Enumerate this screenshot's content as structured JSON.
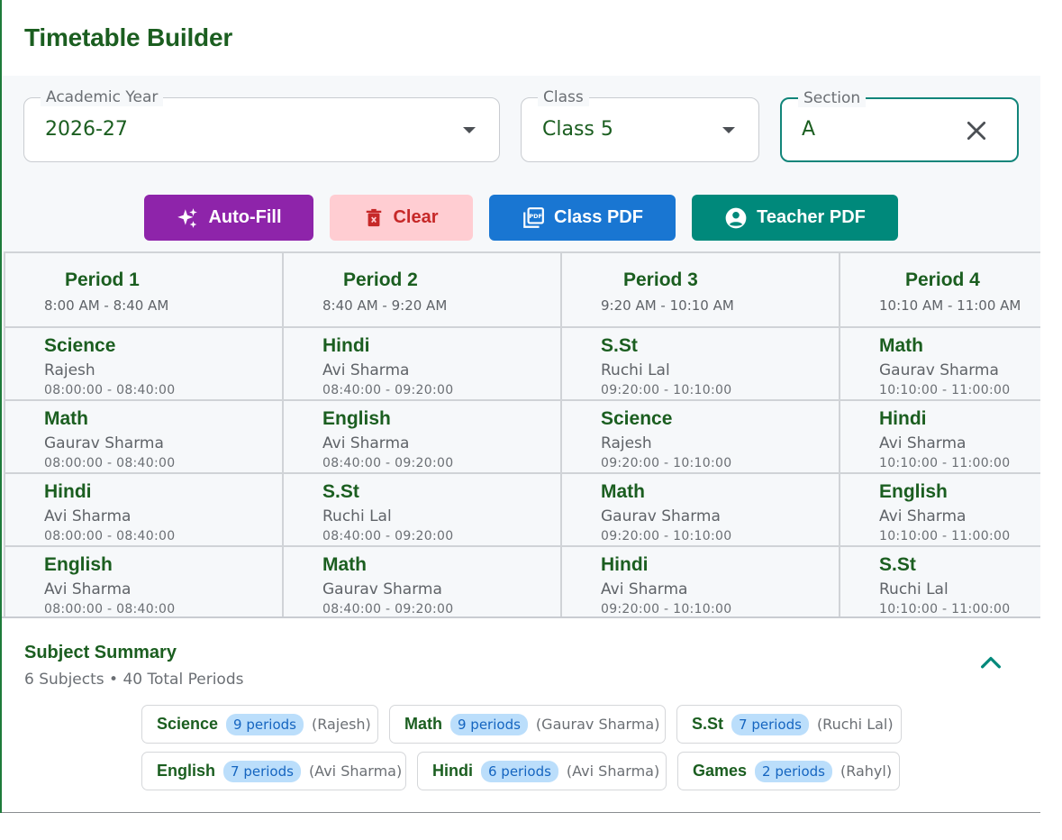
{
  "page": {
    "title": "Timetable Builder"
  },
  "filters": {
    "academic_year": {
      "label": "Academic Year",
      "value": "2026-27"
    },
    "class": {
      "label": "Class",
      "value": "Class 5"
    },
    "section": {
      "label": "Section",
      "value": "A"
    }
  },
  "toolbar": {
    "autofill_label": "Auto-Fill",
    "clear_label": "Clear",
    "class_pdf_label": "Class PDF",
    "teacher_pdf_label": "Teacher PDF"
  },
  "periods": [
    {
      "title": "Period 1",
      "time": "8:00 AM - 8:40 AM"
    },
    {
      "title": "Period 2",
      "time": "8:40 AM - 9:20 AM"
    },
    {
      "title": "Period 3",
      "time": "9:20 AM - 10:10 AM"
    },
    {
      "title": "Period 4",
      "time": "10:10 AM - 11:00 AM"
    }
  ],
  "rows": [
    [
      {
        "subject": "Science",
        "teacher": "Rajesh",
        "slot": "08:00:00 - 08:40:00"
      },
      {
        "subject": "Hindi",
        "teacher": "Avi Sharma",
        "slot": "08:40:00 - 09:20:00"
      },
      {
        "subject": "S.St",
        "teacher": "Ruchi Lal",
        "slot": "09:20:00 - 10:10:00"
      },
      {
        "subject": "Math",
        "teacher": "Gaurav Sharma",
        "slot": "10:10:00 - 11:00:00"
      }
    ],
    [
      {
        "subject": "Math",
        "teacher": "Gaurav Sharma",
        "slot": "08:00:00 - 08:40:00"
      },
      {
        "subject": "English",
        "teacher": "Avi Sharma",
        "slot": "08:40:00 - 09:20:00"
      },
      {
        "subject": "Science",
        "teacher": "Rajesh",
        "slot": "09:20:00 - 10:10:00"
      },
      {
        "subject": "Hindi",
        "teacher": "Avi Sharma",
        "slot": "10:10:00 - 11:00:00"
      }
    ],
    [
      {
        "subject": "Hindi",
        "teacher": "Avi Sharma",
        "slot": "08:00:00 - 08:40:00"
      },
      {
        "subject": "S.St",
        "teacher": "Ruchi Lal",
        "slot": "08:40:00 - 09:20:00"
      },
      {
        "subject": "Math",
        "teacher": "Gaurav Sharma",
        "slot": "09:20:00 - 10:10:00"
      },
      {
        "subject": "English",
        "teacher": "Avi Sharma",
        "slot": "10:10:00 - 11:00:00"
      }
    ],
    [
      {
        "subject": "English",
        "teacher": "Avi Sharma",
        "slot": "08:00:00 - 08:40:00"
      },
      {
        "subject": "Math",
        "teacher": "Gaurav Sharma",
        "slot": "08:40:00 - 09:20:00"
      },
      {
        "subject": "Hindi",
        "teacher": "Avi Sharma",
        "slot": "09:20:00 - 10:10:00"
      },
      {
        "subject": "S.St",
        "teacher": "Ruchi Lal",
        "slot": "10:10:00 - 11:00:00"
      }
    ]
  ],
  "summary": {
    "title": "Subject Summary",
    "subtitle": "6 Subjects • 40 Total Periods",
    "chips": [
      {
        "subject": "Science",
        "periods": "9 periods",
        "teacher": "(Rajesh)"
      },
      {
        "subject": "Math",
        "periods": "9 periods",
        "teacher": "(Gaurav Sharma)"
      },
      {
        "subject": "S.St",
        "periods": "7 periods",
        "teacher": "(Ruchi Lal)"
      },
      {
        "subject": "English",
        "periods": "7 periods",
        "teacher": "(Avi Sharma)"
      },
      {
        "subject": "Hindi",
        "periods": "6 periods",
        "teacher": "(Avi Sharma)"
      },
      {
        "subject": "Games",
        "periods": "2 periods",
        "teacher": "(Rahyl)"
      }
    ]
  },
  "colors": {
    "primary_green": "#1b5e20",
    "autofill": "#8e24aa",
    "clear_bg": "#ffcdd2",
    "clear_text": "#c62828",
    "class_pdf": "#1976d2",
    "teacher_pdf": "#00897b",
    "badge_bg": "#bbdefb"
  }
}
